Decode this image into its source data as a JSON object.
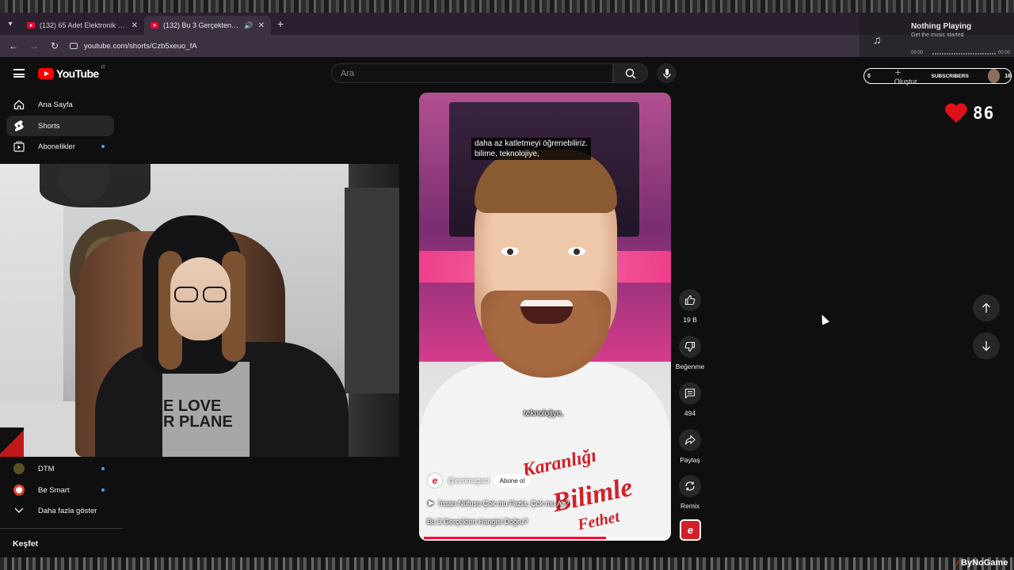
{
  "browser": {
    "tabs": [
      {
        "title": "(132) 65 Adet Elektronik Sigara",
        "active": false
      },
      {
        "title": "(132) Bu 3 Gerçekten Hangi",
        "active": true
      }
    ],
    "url": "youtube.com/shorts/Czb5xeuo_fA"
  },
  "music_widget": {
    "title": "Nothing Playing",
    "subtitle": "Get the music started",
    "time_start": "00:00",
    "time_end": "00:00"
  },
  "masthead": {
    "logo_text": "YouTube",
    "country": "IT",
    "search_placeholder": "Ara",
    "create_label": "Oluştur",
    "subscribers_label": "SUBSCRIBERS",
    "left_count": "0",
    "right_count": "16"
  },
  "heart_counter": {
    "value": "86",
    "color": "#e0101a"
  },
  "sidebar": {
    "items": [
      {
        "label": "Ana Sayfa",
        "icon": "home-icon"
      },
      {
        "label": "Shorts",
        "icon": "shorts-icon"
      },
      {
        "label": "Abonelikler",
        "icon": "subscriptions-icon"
      }
    ],
    "channels": [
      {
        "label": "DTM"
      },
      {
        "label": "Be Smart"
      }
    ],
    "show_more": "Daha fazla göster",
    "section_heading": "Keşfet"
  },
  "webcam": {
    "shirt_text": "E LOVE\nR PLANE"
  },
  "short": {
    "caption_top_line1": "daha az katletmeyi öğrenebiliriz.",
    "caption_top_line2": "bilime, teknolojiye,",
    "caption_mid": "teknolojiye,",
    "shirt_line1": "Karanlığı",
    "shirt_line2": "Bilimle",
    "shirt_line3": "Fethet",
    "channel_handle": "@evrimagaci",
    "subscribe_label": "Abone ol",
    "playlist": "İnsan Nüfusu Çok mu Fazla, Çok mu Az?",
    "title": "Bu 3 Gerçekten Hangisi Doğru?",
    "progress": 0.75
  },
  "actions": {
    "like_count": "19 B",
    "dislike_label": "Beğenme",
    "comment_count": "494",
    "share_label": "Paylaş",
    "remix_label": "Remix"
  },
  "watermark": "ByNoGame",
  "colors": {
    "accent": "#ff0033",
    "brand_red": "#ff0000",
    "link_blue": "#3ea6ff"
  }
}
